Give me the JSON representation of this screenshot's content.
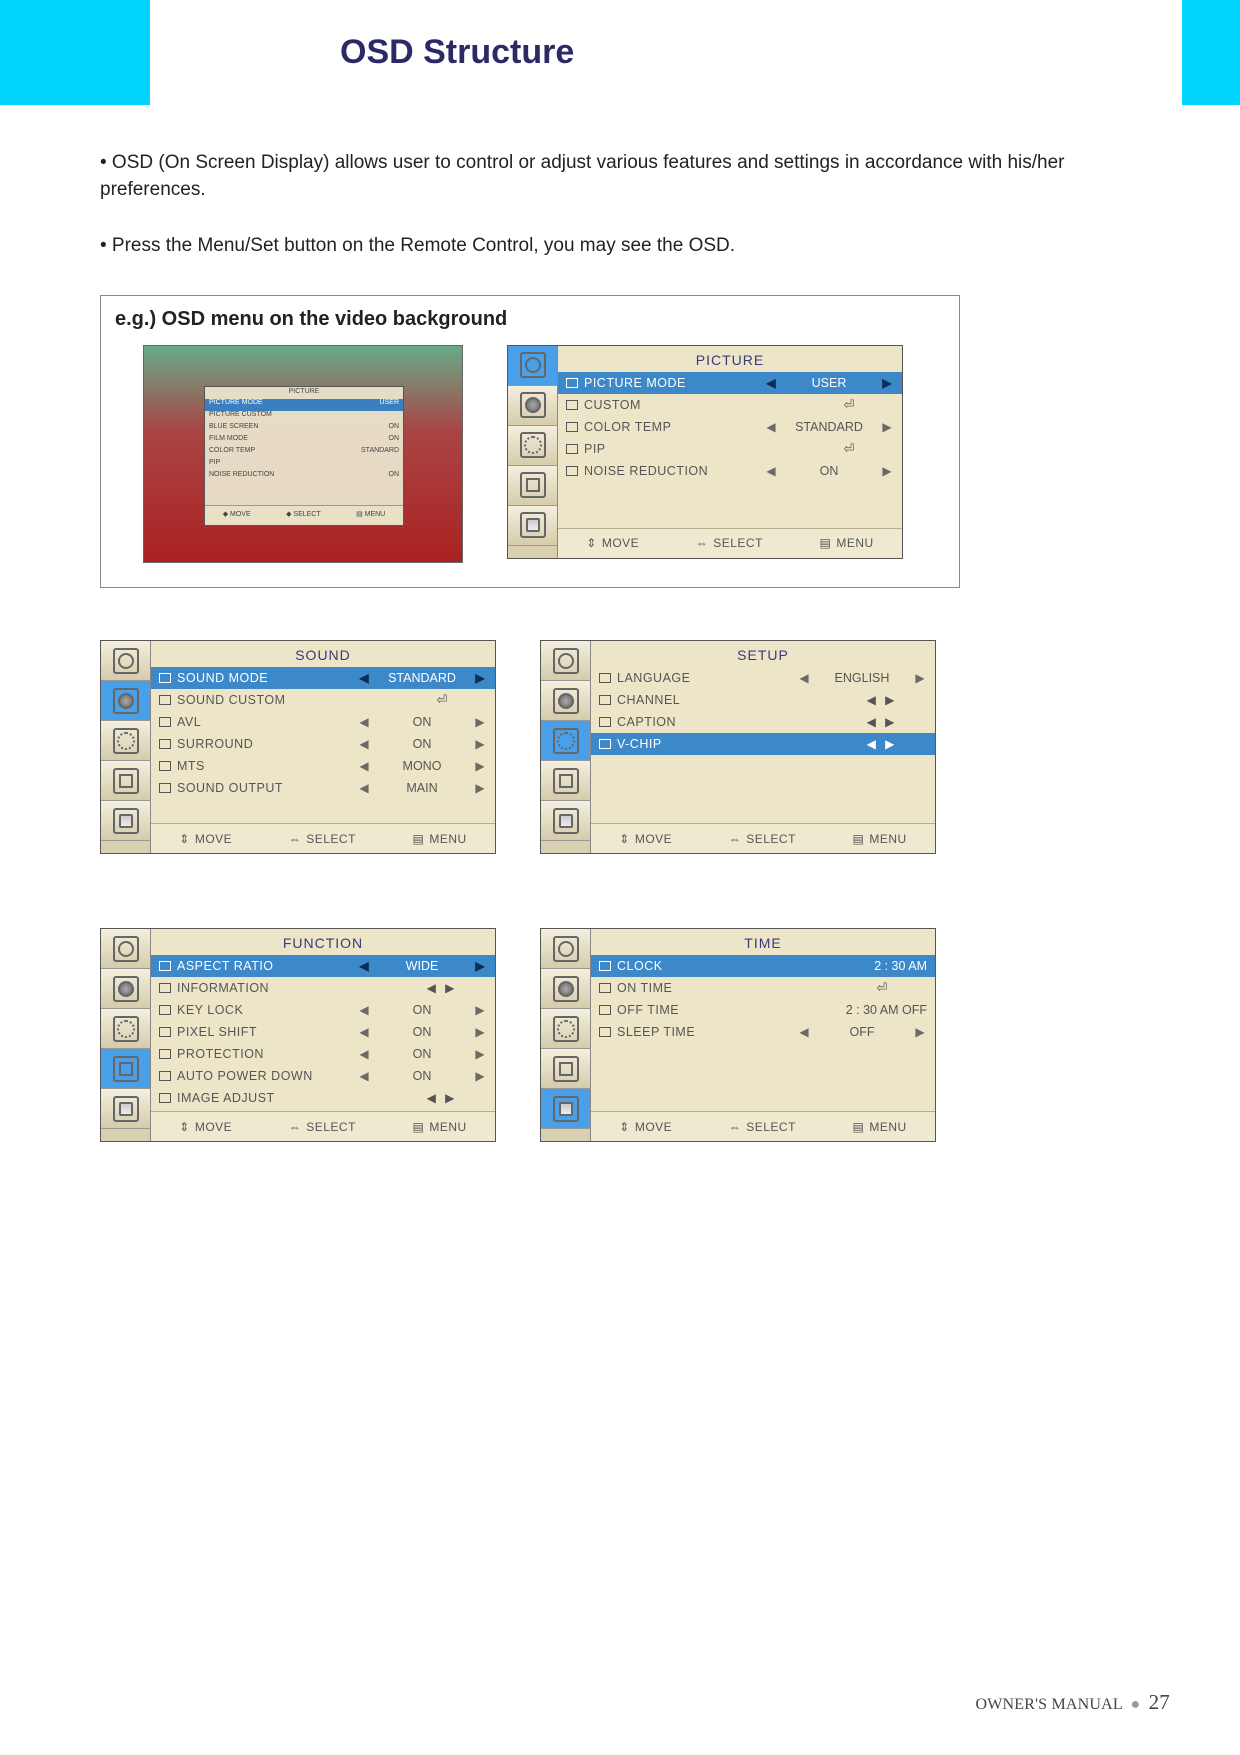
{
  "header": {
    "title": "OSD Structure"
  },
  "intro": {
    "b1": "• OSD (On Screen Display) allows user to control or adjust various features and settings in accordance  with his/her preferences.",
    "b2": "• Press the  Menu/Set button on the Remote Control, you may see the OSD."
  },
  "example": {
    "heading": "e.g.) OSD menu on the video background",
    "mini": {
      "title": "PICTURE",
      "rows": [
        {
          "l": "PICTURE MODE",
          "v": "USER"
        },
        {
          "l": "PICTURE CUSTOM",
          "v": ""
        },
        {
          "l": "BLUE SCREEN",
          "v": "ON"
        },
        {
          "l": "FILM MODE",
          "v": "ON"
        },
        {
          "l": "COLOR TEMP",
          "v": "STANDARD"
        },
        {
          "l": "PIP",
          "v": ""
        },
        {
          "l": "NOISE REDUCTION",
          "v": "ON"
        }
      ]
    }
  },
  "footer_labels": {
    "move": "MOVE",
    "select": "SELECT",
    "menu": "MENU"
  },
  "panels": {
    "picture": {
      "title": "PICTURE",
      "rows": [
        {
          "label": "PICTURE MODE",
          "value": "USER",
          "sel": true,
          "arrows": "bold"
        },
        {
          "label": "CUSTOM",
          "value": "",
          "enter": true
        },
        {
          "label": "COLOR TEMP",
          "value": "STANDARD",
          "arrows": "dim"
        },
        {
          "label": "PIP",
          "value": "",
          "enter": true
        },
        {
          "label": "NOISE REDUCTION",
          "value": "ON",
          "arrows": "dim"
        }
      ]
    },
    "sound": {
      "title": "SOUND",
      "rows": [
        {
          "label": "SOUND MODE",
          "value": "STANDARD",
          "sel": true,
          "arrows": "bold"
        },
        {
          "label": "SOUND CUSTOM",
          "value": "",
          "enter": true
        },
        {
          "label": "AVL",
          "value": "ON",
          "arrows": "dim"
        },
        {
          "label": "SURROUND",
          "value": "ON",
          "arrows": "dim"
        },
        {
          "label": "MTS",
          "value": "MONO",
          "arrows": "dim"
        },
        {
          "label": "SOUND OUTPUT",
          "value": "MAIN",
          "arrows": "dim"
        }
      ]
    },
    "setup": {
      "title": "SETUP",
      "rows": [
        {
          "label": "LANGUAGE",
          "value": "ENGLISH",
          "arrows": "plain"
        },
        {
          "label": "CHANNEL",
          "value": "",
          "pair": true
        },
        {
          "label": "CAPTION",
          "value": "",
          "pair": true
        },
        {
          "label": "V-CHIP",
          "value": "",
          "sel": true,
          "pair": true
        }
      ]
    },
    "func": {
      "title": "FUNCTION",
      "rows": [
        {
          "label": "ASPECT RATIO",
          "value": "WIDE",
          "sel": true,
          "arrows": "bold"
        },
        {
          "label": "INFORMATION",
          "value": "",
          "pair": true
        },
        {
          "label": "KEY LOCK",
          "value": "ON",
          "arrows": "plain"
        },
        {
          "label": "PIXEL SHIFT",
          "value": "ON",
          "arrows": "plain"
        },
        {
          "label": "PROTECTION",
          "value": "ON",
          "arrows": "plain"
        },
        {
          "label": "AUTO POWER DOWN",
          "value": "ON",
          "arrows": "plain"
        },
        {
          "label": "IMAGE ADJUST",
          "value": "",
          "pair": true
        }
      ]
    },
    "time": {
      "title": "TIME",
      "rows": [
        {
          "label": "CLOCK",
          "value": "2 : 30  AM",
          "sel": true
        },
        {
          "label": "ON TIME",
          "value": "",
          "enter": true
        },
        {
          "label": "OFF TIME",
          "value": "2 : 30  AM  OFF"
        },
        {
          "label": "SLEEP TIME",
          "value": "OFF",
          "arrows": "dim"
        }
      ]
    }
  },
  "page_footer": {
    "label": "OWNER'S MANUAL",
    "page": "27"
  }
}
